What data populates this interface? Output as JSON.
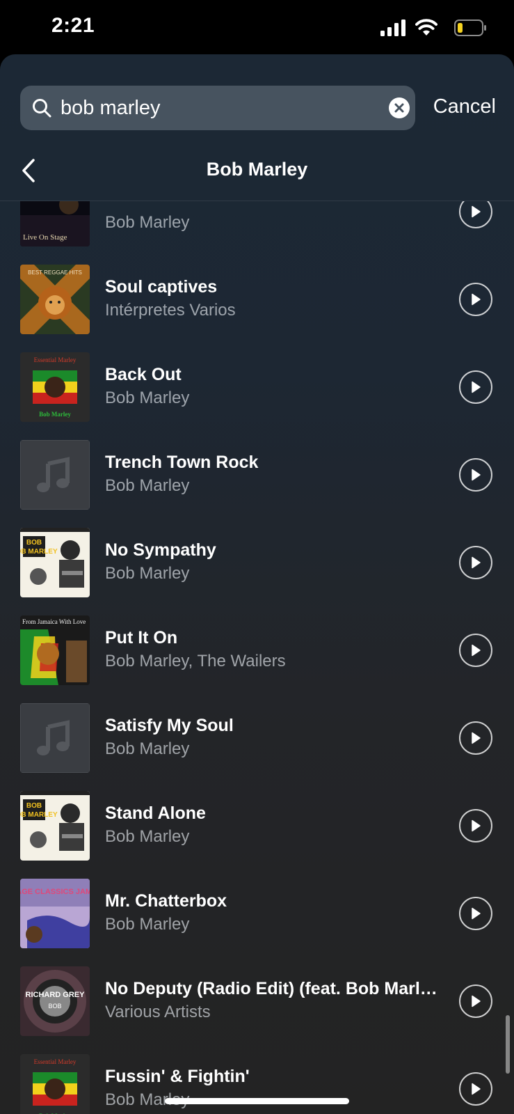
{
  "status_bar": {
    "time": "2:21"
  },
  "search": {
    "query": "bob marley",
    "cancel_label": "Cancel"
  },
  "header": {
    "title": "Bob Marley"
  },
  "tracks": [
    {
      "title": "",
      "artist": "Bob Marley",
      "artwork": "live-on-stage-cover",
      "artwork_text": "Live On Stage"
    },
    {
      "title": "Soul captives",
      "artist": "Intérpretes Varios",
      "artwork": "lion-best-reggae-hits-cover",
      "artwork_text": "BEST REGGAE HITS"
    },
    {
      "title": "Back Out",
      "artist": "Bob Marley",
      "artwork": "essential-marley-cover",
      "artwork_text": "Essential Marley"
    },
    {
      "title": "Trench Town Rock",
      "artist": "Bob Marley",
      "artwork": "music-note-placeholder-icon"
    },
    {
      "title": "No Sympathy",
      "artist": "Bob Marley",
      "artwork": "bob-marley-portrait-cover",
      "artwork_text": "BOB MARLEY"
    },
    {
      "title": "Put It On",
      "artist": "Bob Marley, The Wailers",
      "artwork": "from-jamaica-with-love-cover",
      "artwork_text": "From Jamaica With Love"
    },
    {
      "title": "Satisfy My Soul",
      "artist": "Bob Marley",
      "artwork": "music-note-placeholder-icon"
    },
    {
      "title": "Stand Alone",
      "artist": "Bob Marley",
      "artwork": "bob-marley-portrait-cover",
      "artwork_text": "BOB MARLEY"
    },
    {
      "title": "Mr. Chatterbox",
      "artist": "Bob Marley",
      "artwork": "vintage-classics-jamaica-cover",
      "artwork_text": "VINTAGE CLASSICS JAMAICA"
    },
    {
      "title": "No Deputy (Radio Edit) (feat. Bob Marley)",
      "artist": "Various Artists",
      "artwork": "richard-grey-cover",
      "artwork_text": "RICHARD GREY"
    },
    {
      "title": "Fussin' & Fightin'",
      "artist": "Bob Marley",
      "artwork": "essential-marley-cover",
      "artwork_text": "Essential Marley"
    }
  ]
}
